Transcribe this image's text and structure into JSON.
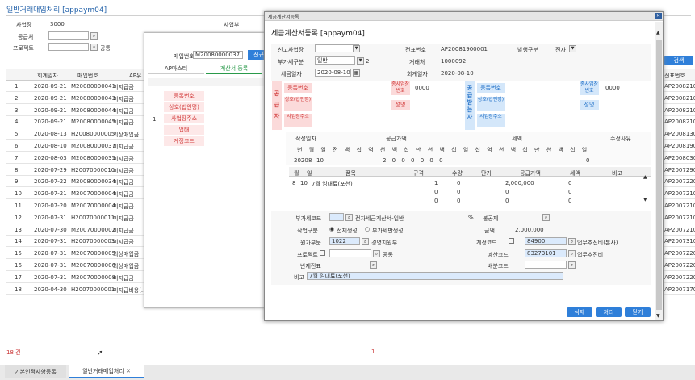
{
  "page": {
    "title": "일반거래매입처리 [appaym04]",
    "count": "18 건",
    "center_num": "1"
  },
  "search": {
    "bizplace_label": "사업장",
    "bizplace_value": "3000",
    "division_label": "사업부",
    "vendor_label": "공급처",
    "project_label": "프로젝트",
    "common_label": "공통",
    "search_btn": "검색"
  },
  "list": {
    "col_date": "회계일자",
    "col_no": "매입번호",
    "col_ap": "AP유",
    "rows": [
      {
        "n": "1",
        "date": "2020-09-21",
        "no": "M20080000041",
        "type": "미지급금"
      },
      {
        "n": "2",
        "date": "2020-09-21",
        "no": "M20080000043",
        "type": "미지급금"
      },
      {
        "n": "3",
        "date": "2020-09-21",
        "no": "M20080000044",
        "type": "미지급금"
      },
      {
        "n": "4",
        "date": "2020-09-21",
        "no": "M20080000045",
        "type": "미지급금"
      },
      {
        "n": "5",
        "date": "2020-08-13",
        "no": "H20080000005",
        "type": "외상매입금"
      },
      {
        "n": "6",
        "date": "2020-08-10",
        "no": "M20080000037",
        "type": "미지급금"
      },
      {
        "n": "7",
        "date": "2020-08-03",
        "no": "M20080000035",
        "type": "미지급금"
      },
      {
        "n": "8",
        "date": "2020-07-29",
        "no": "H20070000010",
        "type": "미지급금"
      },
      {
        "n": "9",
        "date": "2020-07-22",
        "no": "M20080000034",
        "type": "미지급금"
      },
      {
        "n": "10",
        "date": "2020-07-21",
        "no": "M20070000004",
        "type": "미지급금"
      },
      {
        "n": "11",
        "date": "2020-07-20",
        "no": "M20070000004",
        "type": "미지급금"
      },
      {
        "n": "12",
        "date": "2020-07-31",
        "no": "H20070000011",
        "type": "미지급금"
      },
      {
        "n": "13",
        "date": "2020-07-30",
        "no": "M20070000002",
        "type": "미지급금"
      },
      {
        "n": "14",
        "date": "2020-07-31",
        "no": "H20070000003",
        "type": "미지급금"
      },
      {
        "n": "15",
        "date": "2020-07-31",
        "no": "M20070000005",
        "type": "외상매입금"
      },
      {
        "n": "16",
        "date": "2020-07-31",
        "no": "M20070000006",
        "type": "외상매입금"
      },
      {
        "n": "17",
        "date": "2020-07-31",
        "no": "M20070000008",
        "type": "미지급금"
      },
      {
        "n": "18",
        "date": "2020-04-30",
        "no": "H20070000001",
        "type": "미지급비용(..."
      }
    ]
  },
  "right_col": {
    "header": "전표번호",
    "rows": [
      "AP20082100",
      "AP20082100",
      "AP20082100",
      "AP20082100",
      "AP20081300",
      "AP20081900",
      "AP20080300",
      "AP20072900",
      "AP20072200",
      "AP20072100",
      "AP20072100",
      "AP20072100",
      "AP20072100",
      "AP20073100",
      "AP20072200",
      "AP20072200",
      "AP20072200",
      "AP20071700"
    ]
  },
  "mid": {
    "purchase_no_label": "매입번호",
    "purchase_no": "M20080000037",
    "tab_btn": "신규",
    "tab_ap": "AP마스터",
    "tab_tax": "계산서 등록",
    "row_num": "1",
    "f_reg": "등록번호",
    "f_name": "상호(법인명)",
    "f_addr": "사업장주소",
    "f_biz": "업태",
    "f_acct": "계정코드"
  },
  "dialog": {
    "title": "세금계산서등록",
    "heading": "세금계산서등록 [appaym04]",
    "rpt_bizplace": "신고사업장",
    "voucher_label": "전표번호",
    "voucher_no": "AP20081900001",
    "issue_label": "발행구분",
    "issue_value": "전자",
    "vat_label": "부가세구분",
    "vat_value": "일반",
    "vat_num": "2",
    "trade_label": "거래처",
    "trade_value": "1000092",
    "tax_date_label": "세금일자",
    "tax_date": "2020-08-10",
    "acct_date_label": "회계일자",
    "acct_date": "2020-08-10",
    "supplier_label": "공급자",
    "s_reg": "등록번호",
    "s_sub": "종사업장번호",
    "s_sub_val": "0000",
    "s_name": "상호(법인명)",
    "s_rep": "성명",
    "s_addr": "사업장주소",
    "receiver_label": "공급받는자",
    "r_reg": "등록번호",
    "r_sub": "종사업장번호",
    "r_sub_val": "0000",
    "r_name": "상호(법인명)",
    "r_rep": "성명",
    "r_addr": "사업장주소",
    "write_date": "작성일자",
    "supply_amt": "공급가액",
    "tax_amt": "세액",
    "modify": "수정사유",
    "digits": [
      "년",
      "월",
      "일",
      "전",
      "백",
      "십",
      "억",
      "천",
      "백",
      "십",
      "만",
      "천",
      "백",
      "십",
      "일",
      "십",
      "억",
      "천",
      "백",
      "십",
      "만",
      "천",
      "백",
      "십",
      "일"
    ],
    "sum_year": "2020",
    "sum_month": "8",
    "sum_day": "10",
    "sum_zeros": "2 0 0 0 0 0 0",
    "sum_zero": "0",
    "item_cols": [
      "월",
      "일",
      "품목",
      "규격",
      "수량",
      "단가",
      "공급가액",
      "세액",
      "비고"
    ],
    "items": [
      {
        "m": "8",
        "d": "10",
        "name": "7월 임대료(포천)",
        "qty": "1",
        "price": "0",
        "supply": "2,000,000",
        "tax": "0"
      },
      {
        "m": "",
        "d": "",
        "name": "",
        "qty": "0",
        "price": "0",
        "supply": "0",
        "tax": "0"
      },
      {
        "m": "",
        "d": "",
        "name": "",
        "qty": "0",
        "price": "0",
        "supply": "0",
        "tax": "0"
      }
    ],
    "vat_code_label": "부가세코드",
    "vat_code_desc": "전자세금계산서-일반",
    "percent": "%",
    "deduct_label": "불공제",
    "write_type_label": "작업구분",
    "opt_all": "전체생성",
    "opt_vat": "부가세만생성",
    "amount_label": "금액",
    "amount": "2,000,000",
    "orig_dept_label": "원가부문",
    "orig_dept": "1022",
    "orig_dept_name": "경영지원부",
    "acct_code_label": "계정코드",
    "acct_code": "84900",
    "acct_code_name": "업무추진비(본사)",
    "project_label": "프로젝트",
    "common": "공통",
    "budget_label": "예산코드",
    "budget_code": "83273101",
    "budget_name": "업무추진비",
    "return_label": "반제전표",
    "dist_label": "배분코드",
    "memo_label": "비고",
    "memo": "7월 임대료(포천)",
    "btn_delete": "삭제",
    "btn_process": "처리",
    "btn_close": "닫기"
  },
  "tabs": {
    "t1": "기본인적사항등록",
    "t2": "일반거래매입처리"
  },
  "colors": {
    "accent": "#2f7fd9",
    "pink": "#fbdada",
    "blue": "#d4e7fa"
  }
}
